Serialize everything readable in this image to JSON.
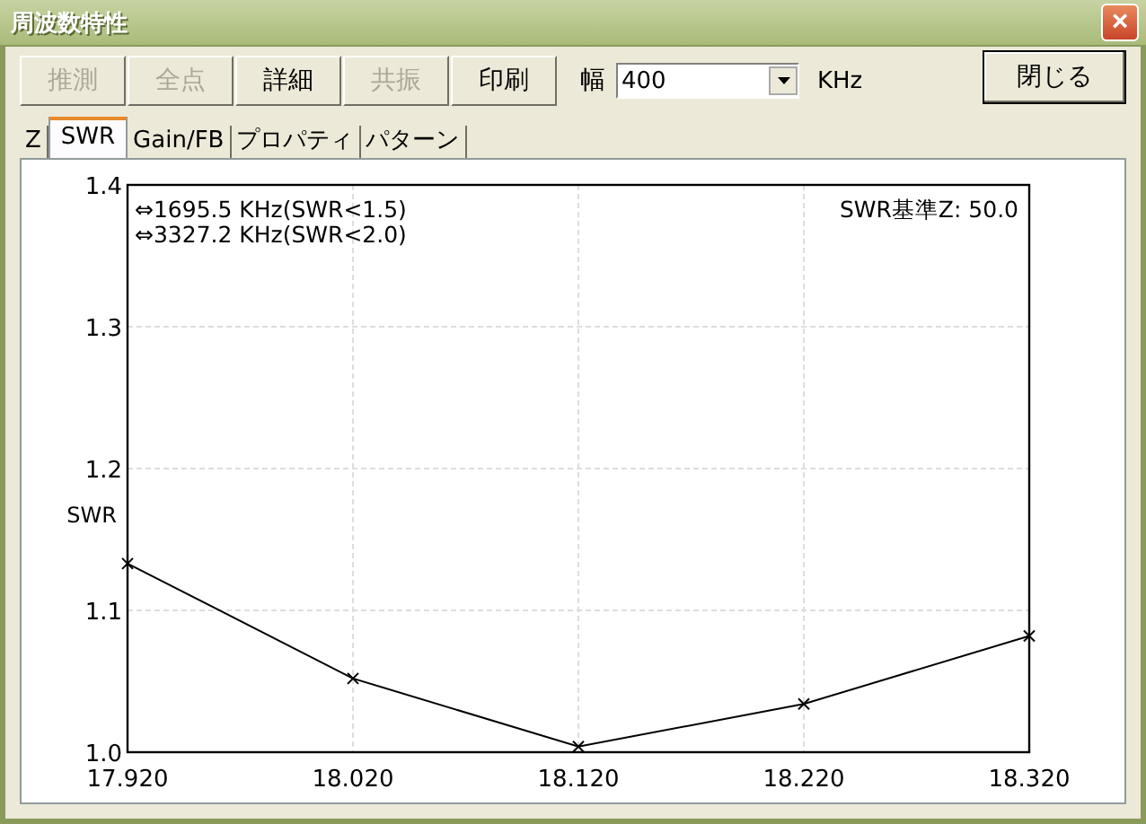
{
  "window": {
    "title": "周波数特性",
    "close": "×"
  },
  "toolbar": {
    "buttons": [
      {
        "label": "推測",
        "disabled": true
      },
      {
        "label": "全点",
        "disabled": true
      },
      {
        "label": "詳細",
        "disabled": false
      },
      {
        "label": "共振",
        "disabled": true
      },
      {
        "label": "印刷",
        "disabled": false
      }
    ],
    "width_label": "幅",
    "width_value": "400",
    "unit": "KHz",
    "close_button": "閉じる"
  },
  "tabs": [
    {
      "label": "Z",
      "selected": false
    },
    {
      "label": "SWR",
      "selected": true
    },
    {
      "label": "Gain/FB",
      "selected": false
    },
    {
      "label": "プロパティ",
      "selected": false
    },
    {
      "label": "パターン",
      "selected": false
    }
  ],
  "chart": {
    "chart_data": {
      "type": "line",
      "grid": true,
      "marker": "x",
      "ylabel": "SWR",
      "x": [
        17.92,
        18.02,
        18.12,
        18.22,
        18.32
      ],
      "values": [
        1.133,
        1.052,
        1.004,
        1.034,
        1.082
      ],
      "xlim": [
        17.92,
        18.32
      ],
      "ylim": [
        1.0,
        1.4
      ],
      "xticks": [
        {
          "value": 17.92,
          "label": "17.920"
        },
        {
          "value": 18.02,
          "label": "18.020"
        },
        {
          "value": 18.12,
          "label": "18.120"
        },
        {
          "value": 18.22,
          "label": "18.220"
        },
        {
          "value": 18.32,
          "label": "18.320"
        }
      ],
      "yticks": [
        {
          "value": 1.0,
          "label": "1.0"
        },
        {
          "value": 1.1,
          "label": "1.1"
        },
        {
          "value": 1.2,
          "label": "1.2"
        },
        {
          "value": 1.3,
          "label": "1.3"
        },
        {
          "value": 1.4,
          "label": "1.4"
        }
      ],
      "annotations": [
        "⇔1695.5 KHz(SWR<1.5)",
        "⇔3327.2 KHz(SWR<2.0)",
        "SWR基準Z: 50.0"
      ]
    }
  }
}
